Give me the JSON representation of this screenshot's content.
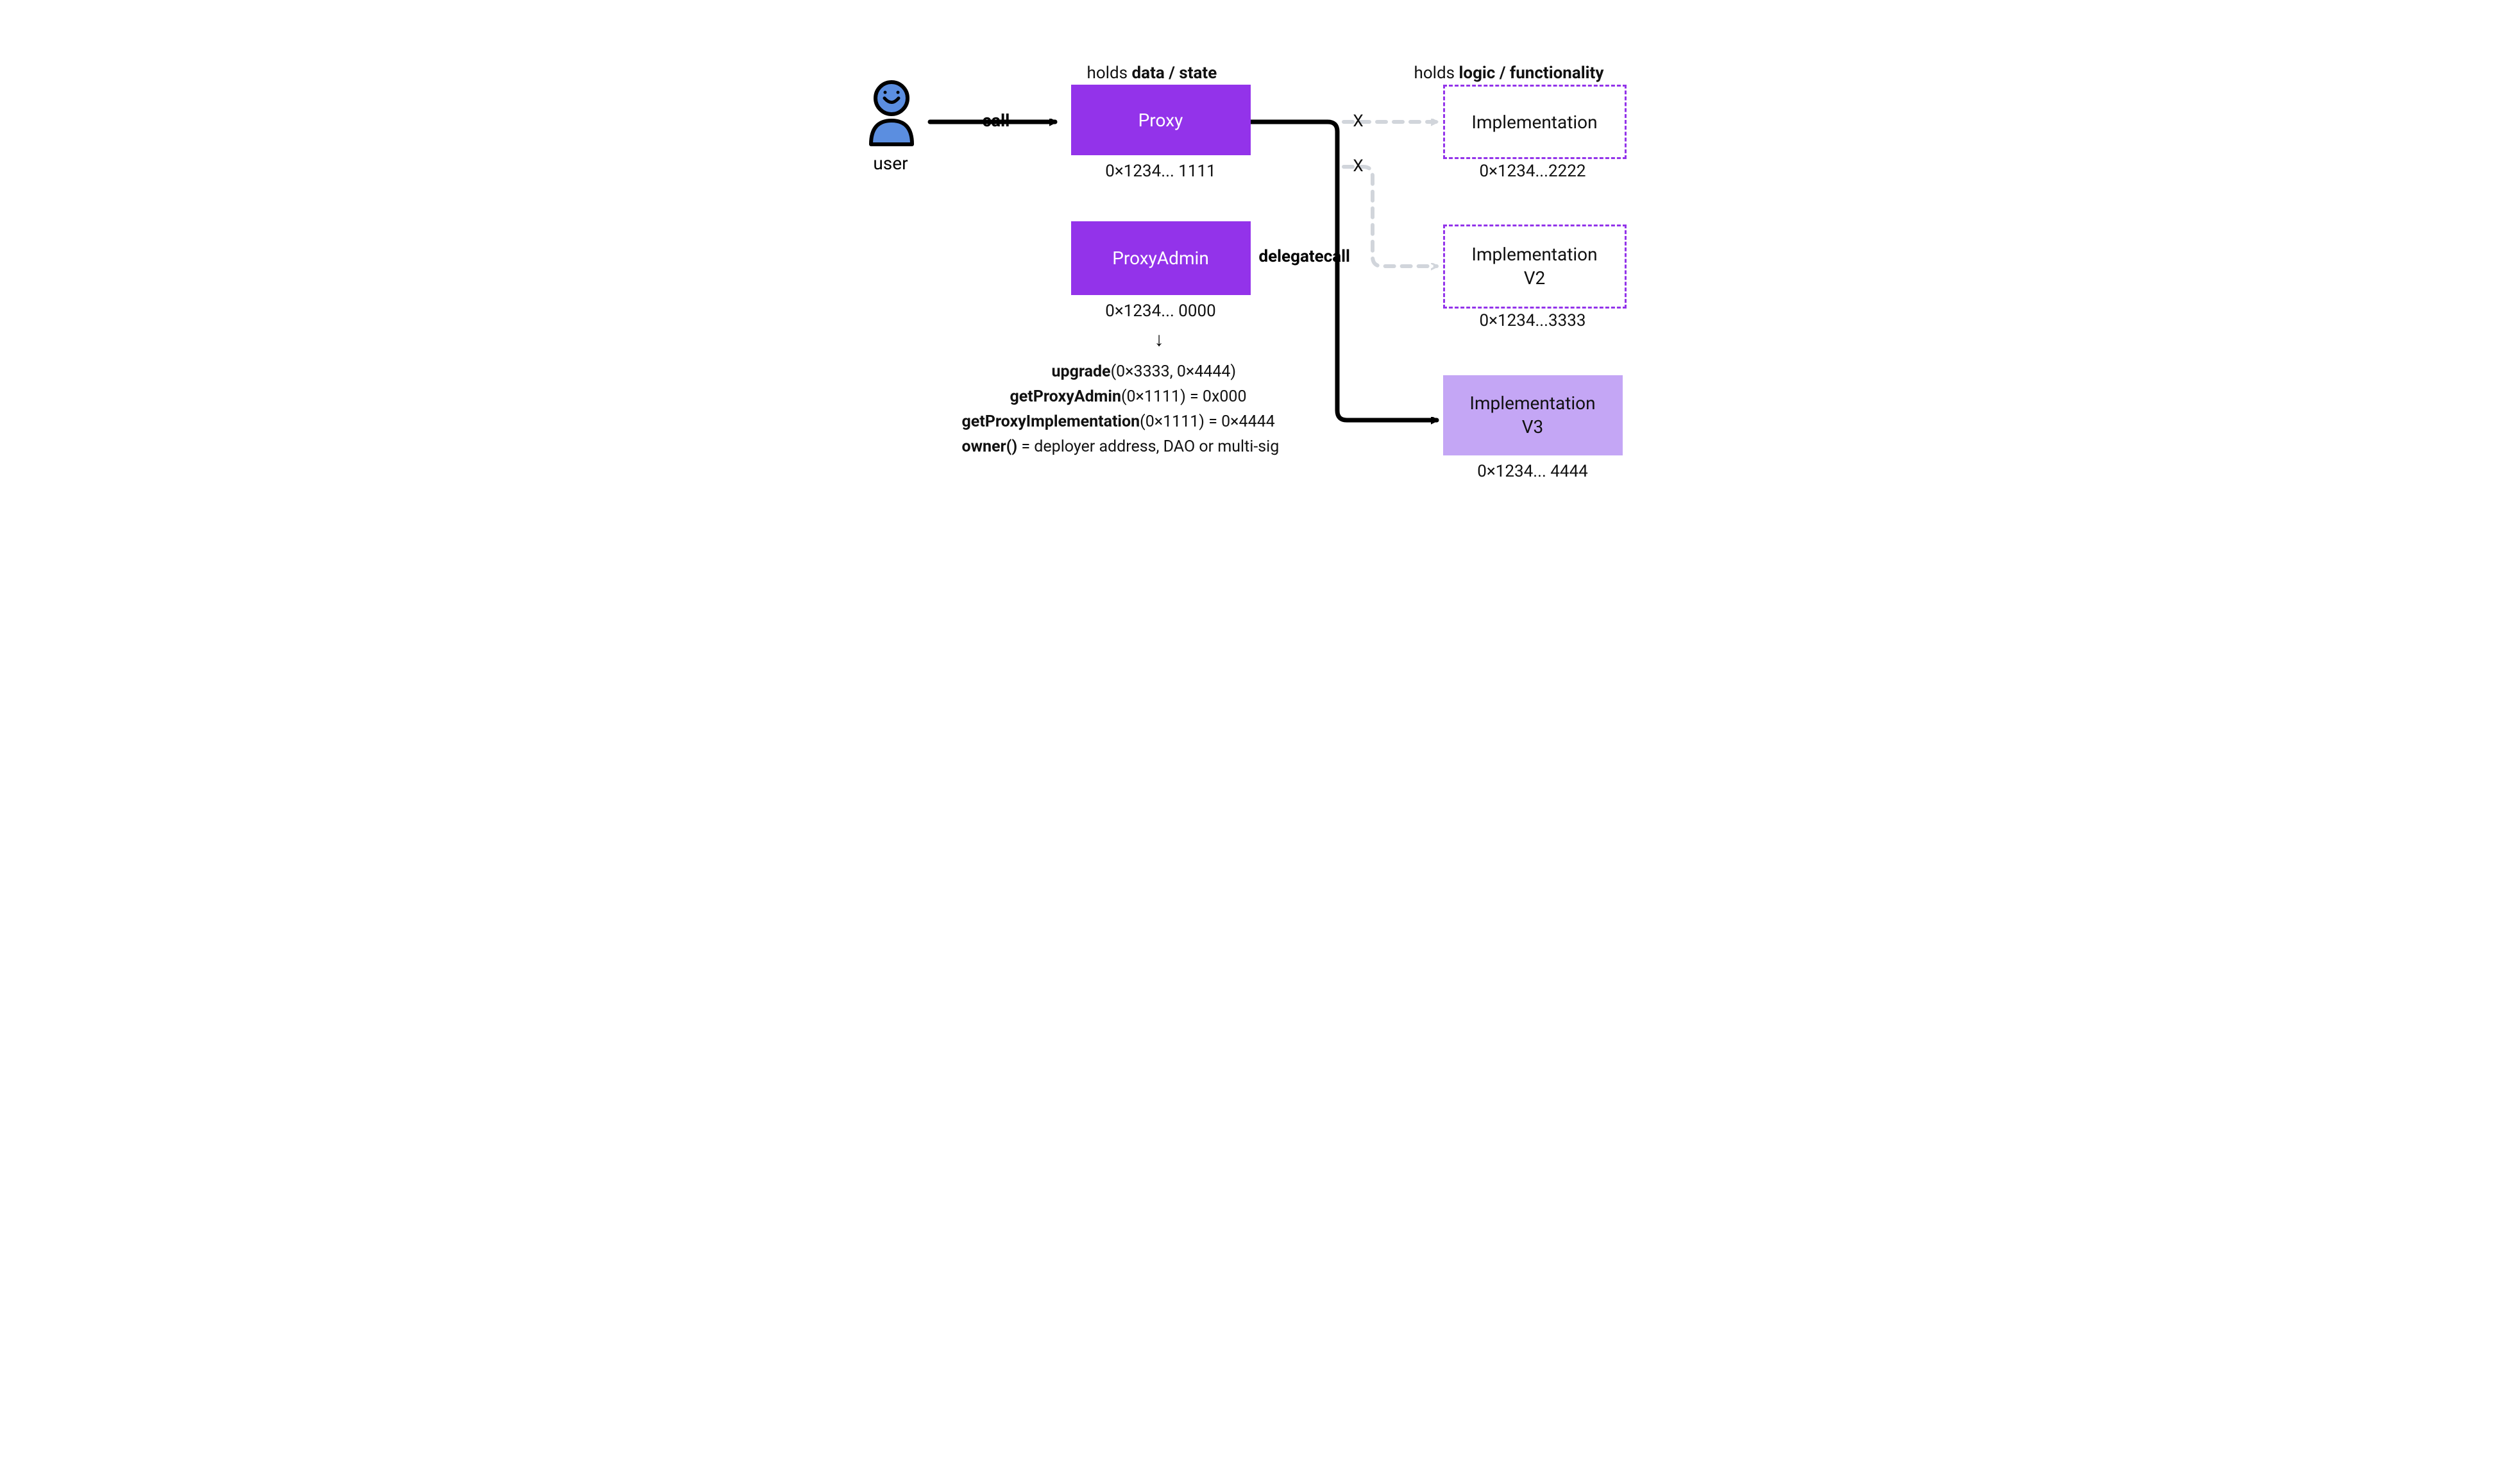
{
  "user_label": "user",
  "call_label": "call",
  "delegatecall_label": "delegatecall",
  "caption_left_prefix": "holds ",
  "caption_left_bold": "data / state",
  "caption_right_prefix": "holds ",
  "caption_right_bold": "logic / functionality",
  "proxy": {
    "title": "Proxy",
    "address": "0×1234... 1111"
  },
  "proxy_admin": {
    "title": "ProxyAdmin",
    "address": "0×1234... 0000"
  },
  "impl1": {
    "title": "Implementation",
    "address": "0×1234...2222"
  },
  "impl2": {
    "title_line1": "Implementation",
    "title_line2": "V2",
    "address": "0×1234...3333"
  },
  "impl3": {
    "title_line1": "Implementation",
    "title_line2": "V3",
    "address": "0×1234... 4444"
  },
  "x1": "X",
  "x2": "X",
  "functions": {
    "upgrade_name": "upgrade",
    "upgrade_args": "(0×3333, 0×4444)",
    "getProxyAdmin_name": "getProxyAdmin",
    "getProxyAdmin_args": "(0×1111) = 0x000",
    "getProxyImpl_name": "getProxyImplementation",
    "getProxyImpl_args": "(0×1111) = 0×4444",
    "owner_name": "owner()",
    "owner_args": " = deployer address, DAO or multi-sig"
  },
  "arrow_down": "↓",
  "colors": {
    "purple": "#9333ea",
    "purple_light": "#c4a6f5",
    "blue": "#5b8ee0"
  }
}
